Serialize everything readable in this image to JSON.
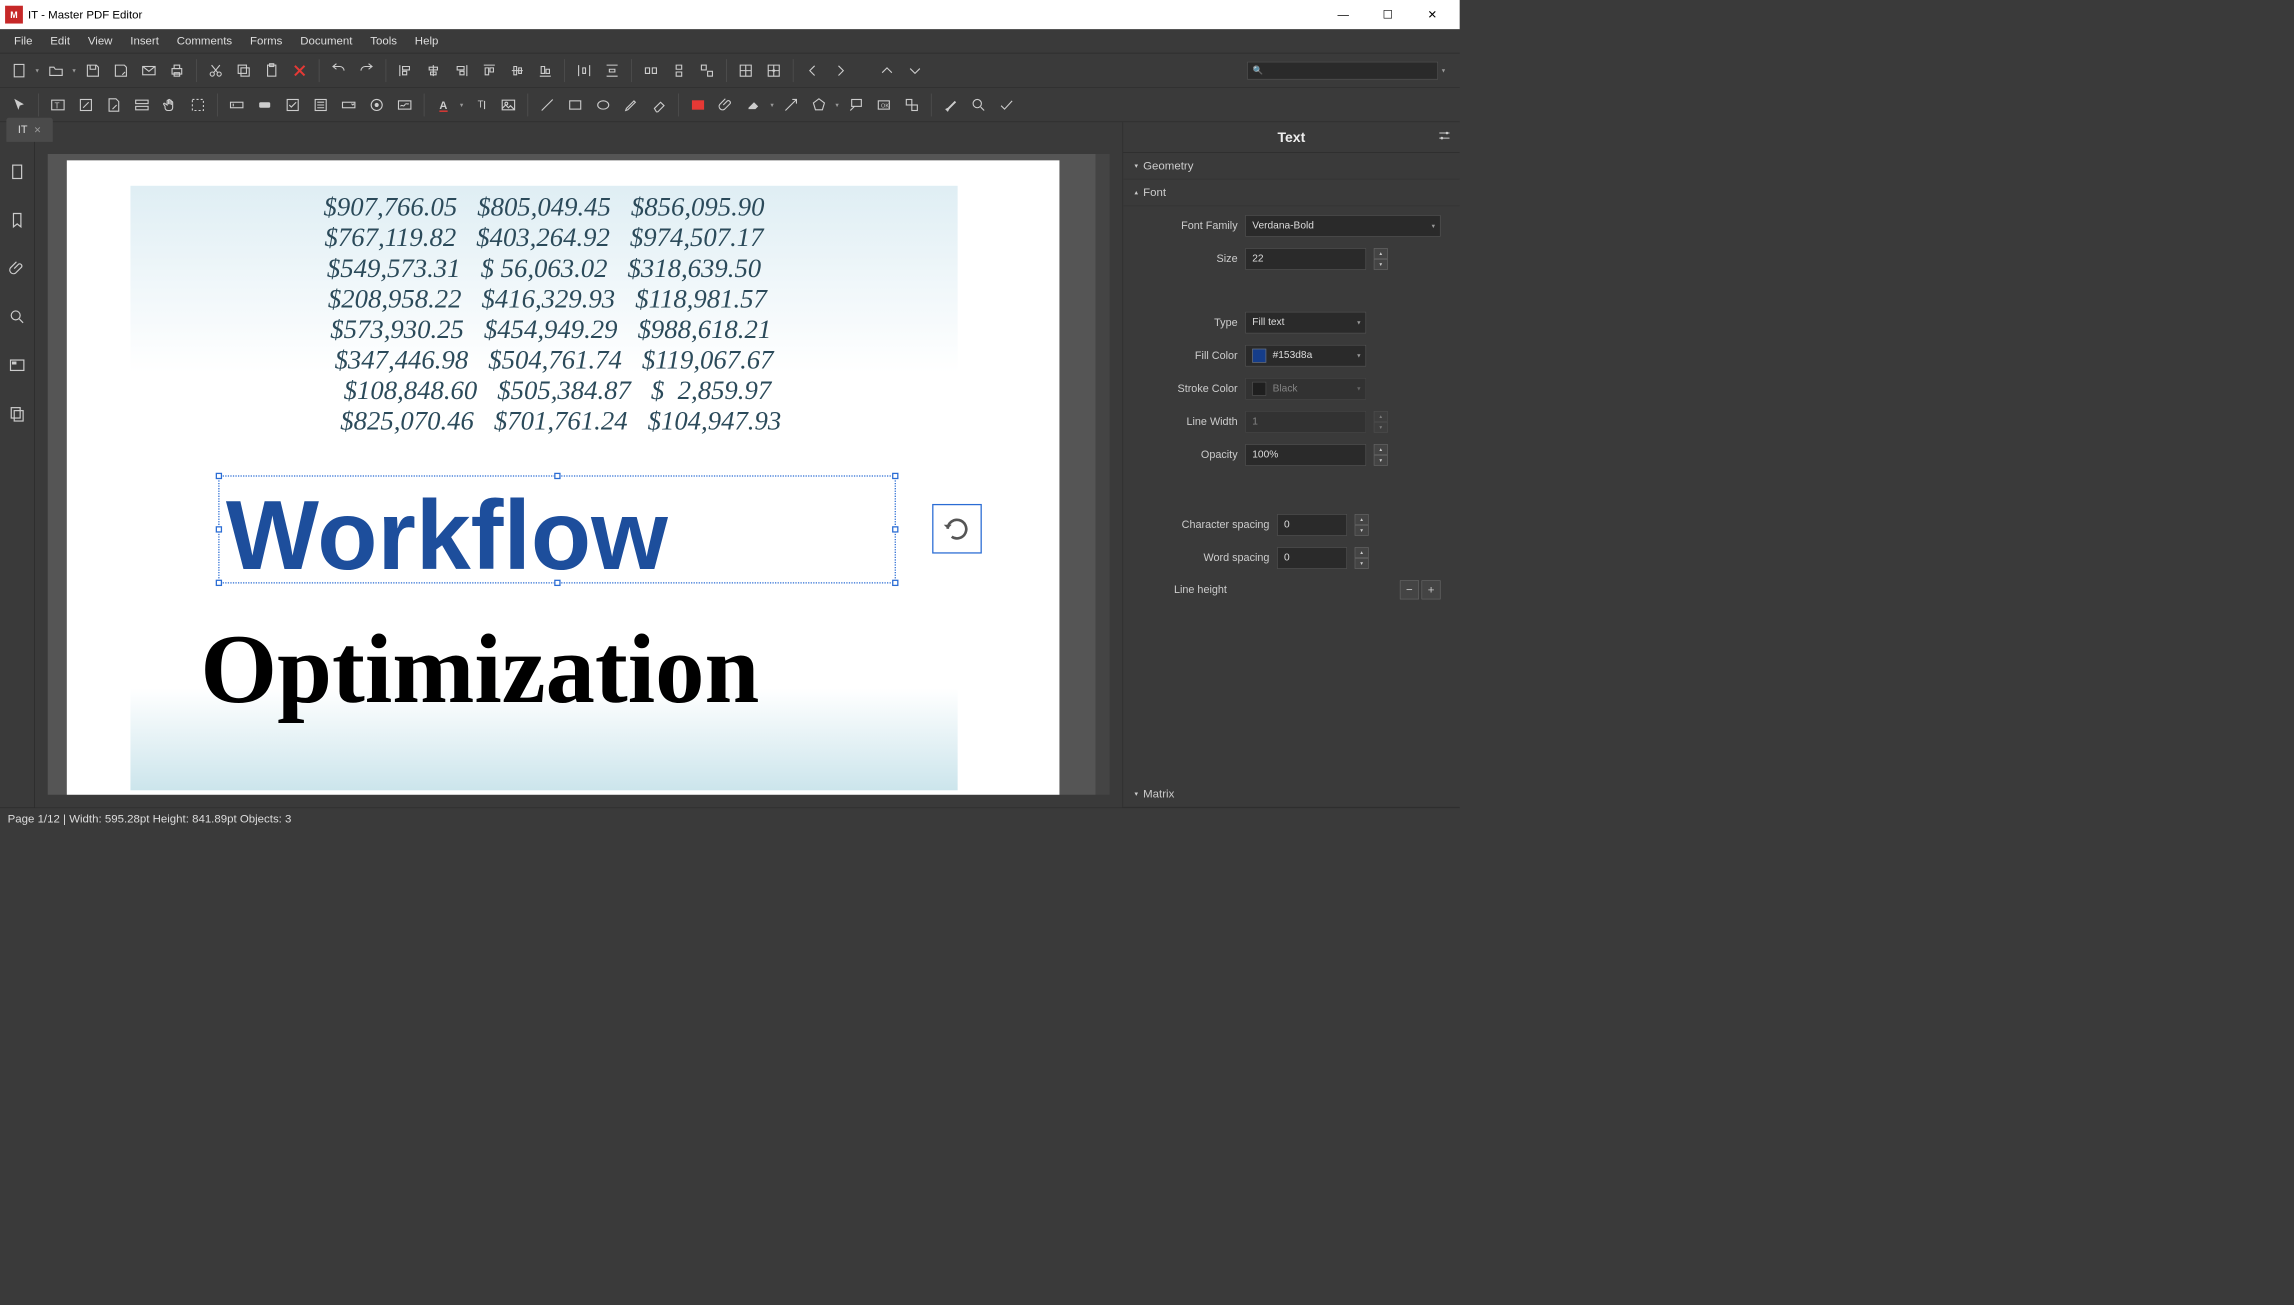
{
  "window": {
    "title": "IT - Master PDF Editor"
  },
  "menu": [
    "File",
    "Edit",
    "View",
    "Insert",
    "Comments",
    "Forms",
    "Document",
    "Tools",
    "Help"
  ],
  "tab": {
    "label": "IT"
  },
  "document": {
    "selected_text": "Workflow",
    "text2": "Optimization",
    "bg_numbers": "$907,766.05   $805,049.45   $856,095.90\n$767,119.82   $403,264.92   $974,507.17\n$549,573.31   $ 56,063.02   $318,639.50\n $208,958.22   $416,329.93   $118,981.57\n  $573,930.25   $454,949.29   $988,618.21\n   $347,446.98   $504,761.74   $119,067.67\n    $108,848.60   $505,384.87   $  2,859.97\n     $825,070.46   $701,761.24   $104,947.93"
  },
  "props": {
    "panel_title": "Text",
    "sections": {
      "geometry": "Geometry",
      "font": "Font",
      "matrix": "Matrix"
    },
    "font_family_label": "Font Family",
    "font_family": "Verdana-Bold",
    "size_label": "Size",
    "size": "22",
    "type_label": "Type",
    "type": "Fill text",
    "fill_label": "Fill Color",
    "fill_hex": "#153d8a",
    "stroke_label": "Stroke Color",
    "stroke_value": "Black",
    "linewidth_label": "Line Width",
    "linewidth": "1",
    "opacity_label": "Opacity",
    "opacity": "100%",
    "charspace_label": "Character spacing",
    "charspace": "0",
    "wordspace_label": "Word spacing",
    "wordspace": "0",
    "lineheight_label": "Line height"
  },
  "status": "Page 1/12 | Width: 595.28pt Height: 841.89pt Objects: 3",
  "search_placeholder": "🔍"
}
